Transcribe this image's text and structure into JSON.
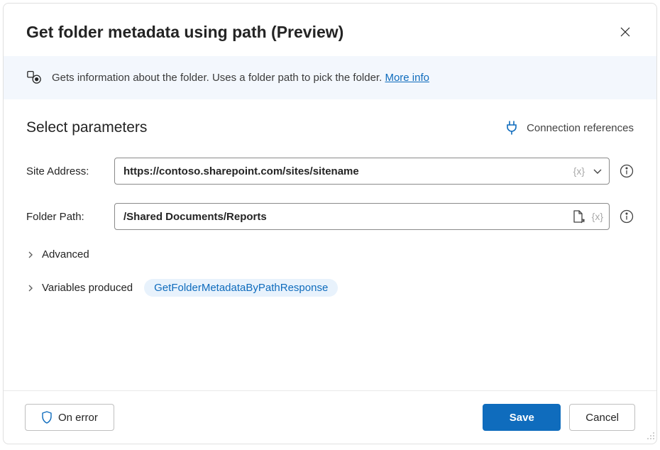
{
  "header": {
    "title": "Get folder metadata using path (Preview)"
  },
  "banner": {
    "text": "Gets information about the folder. Uses a folder path to pick the folder. ",
    "link_label": "More info"
  },
  "section": {
    "title": "Select parameters",
    "connection_references_label": "Connection references"
  },
  "params": {
    "site_address": {
      "label": "Site Address:",
      "value": "https://contoso.sharepoint.com/sites/sitename",
      "fx_token": "{x}"
    },
    "folder_path": {
      "label": "Folder Path:",
      "value": "/Shared Documents/Reports",
      "fx_token": "{x}"
    }
  },
  "advanced": {
    "label": "Advanced"
  },
  "variables": {
    "label": "Variables produced",
    "chip": "GetFolderMetadataByPathResponse"
  },
  "footer": {
    "on_error": "On error",
    "save": "Save",
    "cancel": "Cancel"
  }
}
